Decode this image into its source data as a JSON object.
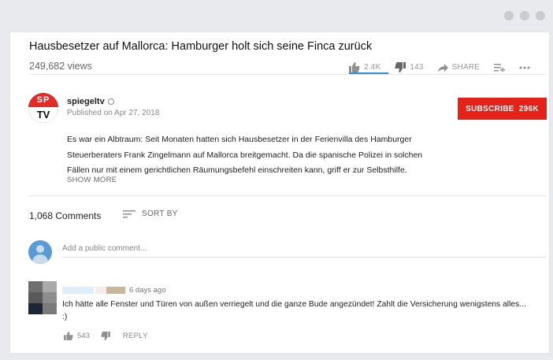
{
  "window": {
    "controls": [
      "dot",
      "dot",
      "dot"
    ]
  },
  "video": {
    "title": "Hausbesetzer auf Mallorca: Hamburger holt sich seine Finca zurück",
    "views": "249,682 views",
    "likes": "2.4K",
    "dislikes": "143",
    "share_label": "SHARE"
  },
  "channel": {
    "avatar_text_top": "SP",
    "avatar_text_bottom": "TV",
    "name": "spiegeltv",
    "published": "Published on Apr 27, 2018",
    "subscribe_label": "SUBSCRIBE",
    "subscriber_count": "296K"
  },
  "description": {
    "lines": [
      "Es war ein Albtraum: Seit Monaten hatten sich Hausbesetzer in der Ferienvilla des Hamburger",
      "Steuerberaters Frank Zingelmann auf Mallorca breitgemacht. Da die spanische Polizei in solchen",
      "Fällen nur mit einem gerichtlichen Räumungsbefehl einschreiten kann, griff er zur Selbsthilfe."
    ],
    "show_more": "SHOW MORE"
  },
  "comments": {
    "count_label": "1,068 Comments",
    "sort_label": "SORT BY",
    "add_placeholder": "Add a public comment...",
    "items": [
      {
        "time": "6 days ago",
        "text_lines": [
          "Ich hätte alle Fenster und Türen von außen verriegelt und die ganze Bude angezündet! Zahlt die Versicherung wenigstens alles...",
          ":)"
        ],
        "likes": "543",
        "reply_label": "REPLY"
      }
    ]
  },
  "colors": {
    "subscribe": "#e62117",
    "like_underline": "#2f8fdc",
    "background": "#e9eaee"
  }
}
